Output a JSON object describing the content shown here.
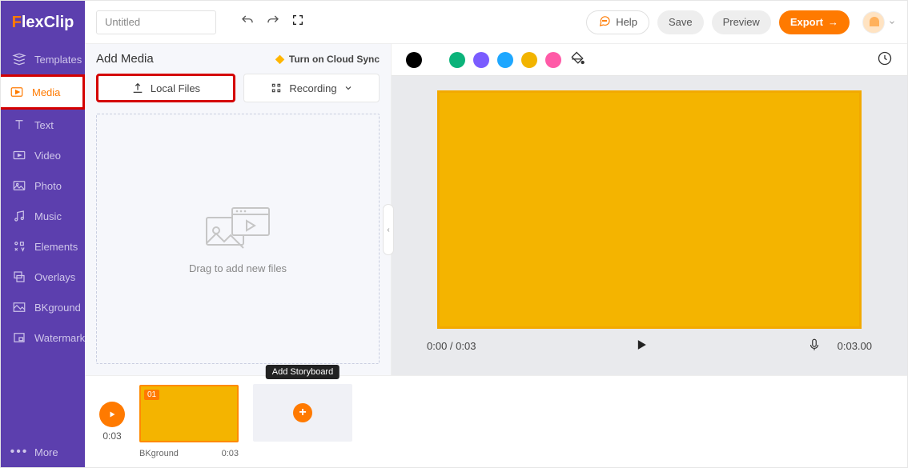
{
  "app": {
    "name": "FlexClip"
  },
  "sidebar": {
    "items": [
      {
        "label": "Templates",
        "icon": "templates"
      },
      {
        "label": "Media",
        "icon": "media",
        "active": true,
        "highlight": true
      },
      {
        "label": "Text",
        "icon": "text"
      },
      {
        "label": "Video",
        "icon": "video"
      },
      {
        "label": "Photo",
        "icon": "photo"
      },
      {
        "label": "Music",
        "icon": "music"
      },
      {
        "label": "Elements",
        "icon": "elements"
      },
      {
        "label": "Overlays",
        "icon": "overlays"
      },
      {
        "label": "BKground",
        "icon": "bkground"
      },
      {
        "label": "Watermark",
        "icon": "watermark"
      }
    ],
    "more_label": "More"
  },
  "topbar": {
    "project_title": "Untitled",
    "help_label": "Help",
    "save_label": "Save",
    "preview_label": "Preview",
    "export_label": "Export"
  },
  "media_panel": {
    "title": "Add Media",
    "cloud_sync_label": "Turn on Cloud Sync",
    "local_files_label": "Local Files",
    "recording_label": "Recording",
    "drop_hint": "Drag to add new files"
  },
  "canvas": {
    "bg_color": "#f4b400",
    "colors": [
      "#000000",
      "#0bb37a",
      "#7a5cff",
      "#1ea7ff",
      "#f2b400",
      "#ff5aa7"
    ]
  },
  "player": {
    "time_current": "0:00",
    "time_total": "0:03",
    "duration_display": "0:03.00"
  },
  "timeline": {
    "head_time": "0:03",
    "clip": {
      "index": "01",
      "name": "BKground",
      "duration": "0:03"
    },
    "add_tooltip": "Add Storyboard"
  }
}
